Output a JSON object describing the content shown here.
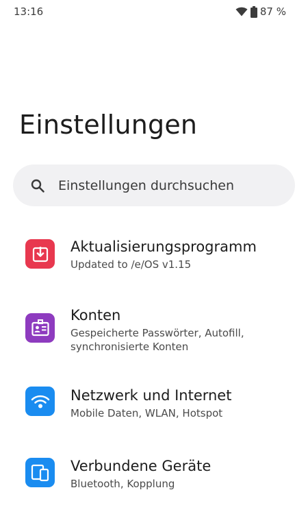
{
  "status_bar": {
    "time": "13:16",
    "battery_percent": "87 %",
    "wifi_icon": "wifi-icon",
    "battery_icon": "battery-icon"
  },
  "page": {
    "title": "Einstellungen"
  },
  "search": {
    "placeholder": "Einstellungen durchsuchen",
    "icon": "search-icon"
  },
  "settings": {
    "items": [
      {
        "title": "Aktualisierungsprogramm",
        "subtitle": "Updated to /e/OS v1.15",
        "icon": "system-update-icon",
        "color": "#e8384f"
      },
      {
        "title": "Konten",
        "subtitle": "Gespeicherte Passwörter, Autofill, synchronisierte Konten",
        "icon": "account-card-icon",
        "color": "#8e3bbf"
      },
      {
        "title": "Netzwerk und Internet",
        "subtitle": "Mobile Daten, WLAN, Hotspot",
        "icon": "wifi-icon",
        "color": "#1a8cf0"
      },
      {
        "title": "Verbundene Geräte",
        "subtitle": "Bluetooth, Kopplung",
        "icon": "connected-devices-icon",
        "color": "#1a8cf0"
      }
    ]
  }
}
